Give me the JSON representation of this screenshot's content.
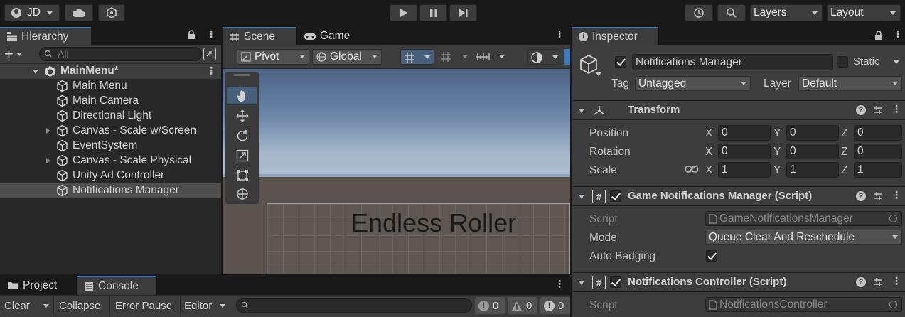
{
  "toolbar": {
    "account_label": "JD",
    "layers_label": "Layers",
    "layout_label": "Layout"
  },
  "hierarchy": {
    "tab_label": "Hierarchy",
    "search_placeholder": "All",
    "scene_name": "MainMenu*",
    "items": [
      {
        "label": "Main Menu",
        "expandable": false
      },
      {
        "label": "Main Camera",
        "expandable": false
      },
      {
        "label": "Directional Light",
        "expandable": false
      },
      {
        "label": "Canvas - Scale w/Screen",
        "expandable": true
      },
      {
        "label": "EventSystem",
        "expandable": false
      },
      {
        "label": "Canvas - Scale Physical",
        "expandable": true
      },
      {
        "label": "Unity Ad Controller",
        "expandable": false
      },
      {
        "label": "Notifications Manager",
        "expandable": false,
        "selected": true
      }
    ]
  },
  "scene": {
    "scene_tab": "Scene",
    "game_tab": "Game",
    "pivot_label": "Pivot",
    "global_label": "Global",
    "canvas_text": "Endless Roller"
  },
  "console": {
    "project_tab": "Project",
    "console_tab": "Console",
    "clear_label": "Clear",
    "collapse_label": "Collapse",
    "error_pause_label": "Error Pause",
    "editor_label": "Editor",
    "log_count": "0",
    "warn_count": "0",
    "error_count": "0"
  },
  "inspector": {
    "tab_label": "Inspector",
    "object_name": "Notifications Manager",
    "static_label": "Static",
    "tag_label": "Tag",
    "tag_value": "Untagged",
    "layer_label": "Layer",
    "layer_value": "Default",
    "transform": {
      "title": "Transform",
      "position_label": "Position",
      "rotation_label": "Rotation",
      "scale_label": "Scale",
      "axis_x": "X",
      "axis_y": "Y",
      "axis_z": "Z",
      "position": [
        "0",
        "0",
        "0"
      ],
      "rotation": [
        "0",
        "0",
        "0"
      ],
      "scale": [
        "1",
        "1",
        "1"
      ]
    },
    "game_notifications": {
      "title": "Game Notifications Manager (Script)",
      "script_label": "Script",
      "script_value": "GameNotificationsManager",
      "mode_label": "Mode",
      "mode_value": "Queue Clear And Reschedule",
      "auto_badging_label": "Auto Badging",
      "auto_badging": true
    },
    "notifications_controller": {
      "title": "Notifications Controller (Script)",
      "script_label": "Script",
      "script_value": "NotificationsController"
    }
  },
  "colors": {
    "accent": "#3a79bb",
    "background": "#191919",
    "panel": "#282828"
  }
}
